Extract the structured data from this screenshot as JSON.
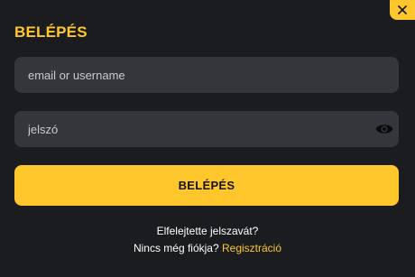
{
  "modal": {
    "title": "BELÉPÉS",
    "close_icon": "close-icon",
    "email": {
      "placeholder": "email or username",
      "value": ""
    },
    "password": {
      "placeholder": "jelszó",
      "value": "",
      "toggle_icon": "eye-icon"
    },
    "submit_label": "BELÉPÉS",
    "forgot_label": "Elfelejtette jelszavát?",
    "no_account_label": "Nincs még fiókja?",
    "register_label": "Regisztráció"
  },
  "colors": {
    "background": "#1b1c20",
    "input_bg": "#35363c",
    "accent": "#ffc72c",
    "text": "#ffffff"
  }
}
